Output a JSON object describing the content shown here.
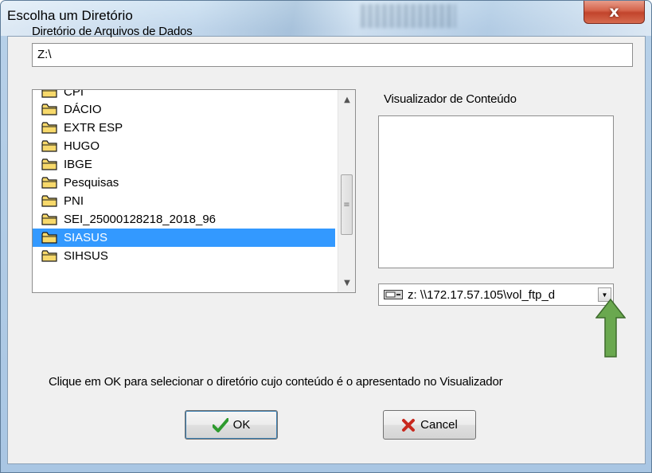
{
  "window": {
    "title": "Escolha um Diretório",
    "close_glyph": "x"
  },
  "path": {
    "label": "Diretório de Arquivos de Dados",
    "value": "Z:\\"
  },
  "folders": {
    "items": [
      "CPI",
      "DÁCIO",
      "EXTR ESP",
      "HUGO",
      "IBGE",
      "Pesquisas",
      "PNI",
      "SEI_25000128218_2018_96",
      "SIASUS",
      "SIHSUS"
    ],
    "selected": "SIASUS"
  },
  "preview": {
    "label": "Visualizador de Conteúdo"
  },
  "drive": {
    "selected": "z: \\\\172.17.57.105\\vol_ftp_d"
  },
  "instruction": "Clique em OK para selecionar o diretório cujo conteúdo é o apresentado no Visualizador",
  "buttons": {
    "ok_label": "OK",
    "cancel_label": "Cancel"
  },
  "colors": {
    "selection": "#3399ff",
    "arrow_green": "#6aa84f",
    "close_red": "#c7472f"
  }
}
